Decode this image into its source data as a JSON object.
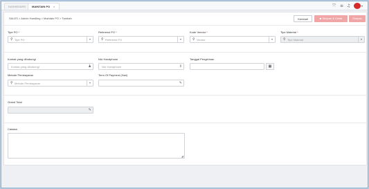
{
  "tabs": [
    {
      "label": "DASHBOARD"
    },
    {
      "label": "MAINTAIN PO",
      "close": "×"
    }
  ],
  "toolbar": {
    "icons": [
      "expand-icon",
      "list-icon",
      "bell-icon"
    ],
    "avatar_caret": "▾"
  },
  "breadcrumb": "SALES > Admin Handling > Maintain PO > Tambah",
  "buttons": {
    "back": "Kembali",
    "save_print": "Simpan & Cetak",
    "save": "Simpan"
  },
  "form": {
    "tipe_po": {
      "label": "Tipe PO",
      "req": "*",
      "placeholder": "Tipe PO"
    },
    "referensi_po": {
      "label": "Referensi PO",
      "req": "*",
      "placeholder": "Referensi PO"
    },
    "kode_vendor": {
      "label": "Kode Vendor",
      "req": "*",
      "placeholder": "Vendor"
    },
    "tipe_material": {
      "label": "Tipe Material",
      "req": "*",
      "placeholder": "Tipe Material"
    },
    "kontak": {
      "label": "Kontak yang dihubungi",
      "placeholder": "Kontak yang dihubungi"
    },
    "no_handphone": {
      "label": "Nür Handphone",
      "placeholder": "Nür Handphone"
    },
    "tanggal_pengiriman": {
      "label": "Tanggal Pengiriman",
      "value": ""
    },
    "metode_pembayaran": {
      "label": "Metode Pembayaran",
      "placeholder": "Metode Pembayaran"
    },
    "term_payment": {
      "label": "Term Of Payment (Hari)",
      "value": ""
    },
    "grand_total": {
      "label": "Grand Total",
      "value": ""
    },
    "catatan": {
      "label": "Catatan",
      "value": ""
    }
  },
  "colors": {
    "accent": "#d42a2a",
    "disabled_button": "#f0a6a6"
  }
}
